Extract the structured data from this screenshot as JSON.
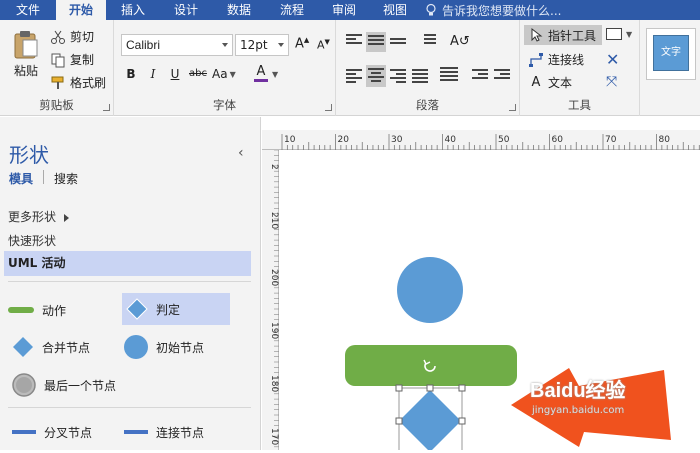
{
  "tabs": [
    "文件",
    "开始",
    "插入",
    "设计",
    "数据",
    "流程",
    "审阅",
    "视图"
  ],
  "active_tab": "开始",
  "tell_me": "告诉我您想要做什么...",
  "clipboard": {
    "paste": "粘贴",
    "cut": "剪切",
    "copy": "复制",
    "format_painter": "格式刷",
    "label": "剪贴板"
  },
  "font": {
    "family": "Calibri",
    "size": "12pt",
    "bold": "B",
    "italic": "I",
    "underline": "U",
    "strike": "abc",
    "case": "Aa",
    "color_a": "A",
    "label": "字体"
  },
  "paragraph": {
    "label": "段落"
  },
  "tools": {
    "pointer": "指针工具",
    "connector": "连接线",
    "text": "文本",
    "label": "工具"
  },
  "style_preview": "文字",
  "pane": {
    "title": "形状",
    "tab_stencils": "模具",
    "tab_search": "搜索",
    "more_shapes": "更多形状",
    "quick_shapes": "快速形状",
    "stencil": "UML 活动"
  },
  "shapes": [
    {
      "label": "动作",
      "icon": "action-bar-icon"
    },
    {
      "label": "判定",
      "icon": "decision-diamond-icon"
    },
    {
      "label": "合并节点",
      "icon": "merge-diamond-icon"
    },
    {
      "label": "初始节点",
      "icon": "initial-circle-icon"
    },
    {
      "label": "最后一个节点",
      "icon": "final-node-icon"
    },
    {
      "label": "分叉节点",
      "icon": "fork-bar-icon"
    },
    {
      "label": "连接节点",
      "icon": "join-bar-icon"
    }
  ],
  "ruler_h": [
    "10",
    "20",
    "30",
    "40",
    "50",
    "60",
    "70",
    "80"
  ],
  "ruler_v": [
    "2",
    "210",
    "200",
    "190",
    "180",
    "170"
  ],
  "watermark": {
    "text": "Baidu经验",
    "url": "jingyan.baidu.com"
  },
  "colors": {
    "brand_blue": "#2e5aa8",
    "shape_blue": "#5b9bd5",
    "action_green": "#70ad47",
    "arrow_orange": "#f0521e",
    "selection": "#c9d4f3"
  }
}
